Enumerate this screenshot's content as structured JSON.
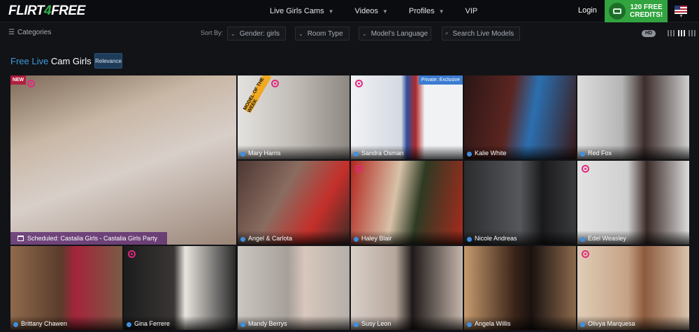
{
  "header": {
    "logo_left": "FLIRT",
    "logo_mid": "4",
    "logo_right": "FREE",
    "nav": [
      {
        "label": "Live Girls Cams",
        "has_menu": true
      },
      {
        "label": "Videos",
        "has_menu": true
      },
      {
        "label": "Profiles",
        "has_menu": true
      },
      {
        "label": "VIP",
        "has_menu": false
      }
    ],
    "login": "Login",
    "credits_line1": "120 FREE",
    "credits_line2": "CREDITS!"
  },
  "filters": {
    "categories": "Categories",
    "sort_by": "Sort By:",
    "gender": "Gender: girls",
    "room_type": "Room Type",
    "language": "Model's Language",
    "search_placeholder": "Search Live Models",
    "hd": "HD"
  },
  "heading": {
    "highlight": "Free Live",
    "rest": "Cam Girls",
    "sort_button": "Relevance"
  },
  "tiles": [
    {
      "name": "Castalia Girls",
      "caption": "Scheduled: Castalia Girls - Castalia Girls Party",
      "badge": "NEW",
      "bg": "#b9a79a"
    },
    {
      "name": "Mary Harris",
      "caption": "Mary Harris",
      "badge": "MODEL OF THE WEEK",
      "bg": "#d7d5d2"
    },
    {
      "name": "Sandra Osman",
      "caption": "Sandra Osman",
      "badge": "Private: Exclusive",
      "bg": "#eef0f2"
    },
    {
      "name": "Kalie White",
      "caption": "Kalie White",
      "bg": "#4a1f1f"
    },
    {
      "name": "Red Fox",
      "caption": "Red Fox",
      "bg": "#cfcfcf"
    },
    {
      "name": "Angel & Carlota",
      "caption": "Angel & Carlota",
      "bg": "#5a4540"
    },
    {
      "name": "Haley Blair",
      "caption": "Haley Blair",
      "bg": "#8a2a22"
    },
    {
      "name": "Nicole Andreas",
      "caption": "Nicole Andreas",
      "bg": "#3c3d40"
    },
    {
      "name": "Edel Weasley",
      "caption": "Edel Weasley",
      "bg": "#d3d3d3"
    },
    {
      "name": "Brittany Chawen",
      "caption": "Brittany Chawen",
      "bg": "#7a5a45"
    },
    {
      "name": "Gina Ferrere",
      "caption": "Gina Ferrere",
      "bg": "#262626"
    },
    {
      "name": "Mandy Berrys",
      "caption": "Mandy Berrys",
      "bg": "#b4afa8"
    },
    {
      "name": "Susy Leon",
      "caption": "Susy Leon",
      "bg": "#c4b5ab"
    },
    {
      "name": "Angela Willis",
      "caption": "Angela Willis",
      "bg": "#6b4a35"
    },
    {
      "name": "Olivya Marquesa",
      "caption": "Olivya Marquesa",
      "bg": "#c9b29a"
    }
  ]
}
